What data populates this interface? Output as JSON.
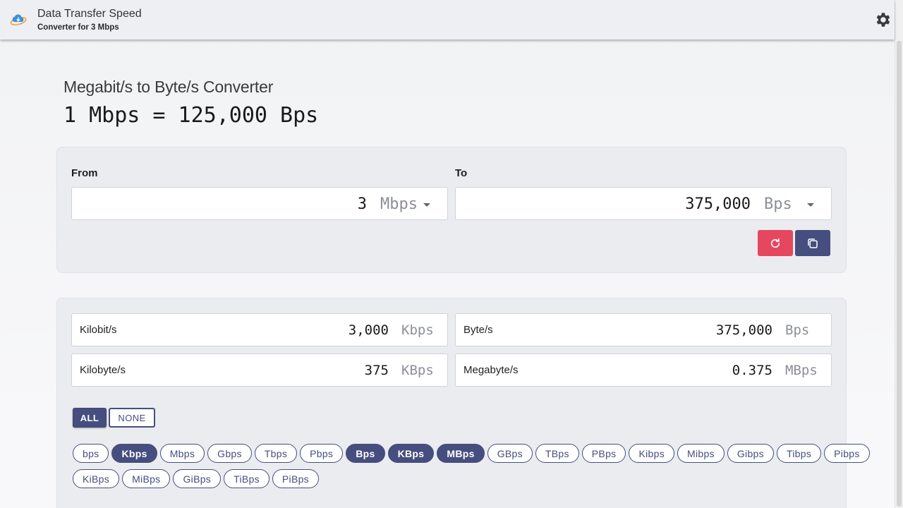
{
  "header": {
    "title": "Data Transfer Speed",
    "subtitle": "Converter for 3 Mbps",
    "logo_icon": "cloud-transfer-icon",
    "settings_icon": "gear-icon"
  },
  "page": {
    "heading": "Megabit/s to Byte/s Converter",
    "formula": "1 Mbps = 125,000 Bps"
  },
  "converter": {
    "from_label": "From",
    "to_label": "To",
    "from_value": "3",
    "from_unit": "Mbps",
    "to_value": "375,000",
    "to_unit": "Bps",
    "reset_icon": "refresh-icon",
    "copy_icon": "copy-icon"
  },
  "results": [
    {
      "label": "Kilobit/s",
      "value": "3,000",
      "unit": "Kbps"
    },
    {
      "label": "Byte/s",
      "value": "375,000",
      "unit": "Bps"
    },
    {
      "label": "Kilobyte/s",
      "value": "375",
      "unit": "KBps"
    },
    {
      "label": "Megabyte/s",
      "value": "0.375",
      "unit": "MBps"
    }
  ],
  "selection": {
    "all_label": "ALL",
    "none_label": "NONE"
  },
  "units_row1": [
    {
      "label": "bps",
      "selected": false
    },
    {
      "label": "Kbps",
      "selected": true
    },
    {
      "label": "Mbps",
      "selected": false
    },
    {
      "label": "Gbps",
      "selected": false
    },
    {
      "label": "Tbps",
      "selected": false
    },
    {
      "label": "Pbps",
      "selected": false
    },
    {
      "label": "Bps",
      "selected": true
    },
    {
      "label": "KBps",
      "selected": true
    },
    {
      "label": "MBps",
      "selected": true
    },
    {
      "label": "GBps",
      "selected": false
    },
    {
      "label": "TBps",
      "selected": false
    },
    {
      "label": "PBps",
      "selected": false
    },
    {
      "label": "Kibps",
      "selected": false
    },
    {
      "label": "Mibps",
      "selected": false
    },
    {
      "label": "Gibps",
      "selected": false
    },
    {
      "label": "Tibps",
      "selected": false
    },
    {
      "label": "Pibps",
      "selected": false
    }
  ],
  "units_row2": [
    {
      "label": "KiBps",
      "selected": false
    },
    {
      "label": "MiBps",
      "selected": false
    },
    {
      "label": "GiBps",
      "selected": false
    },
    {
      "label": "TiBps",
      "selected": false
    },
    {
      "label": "PiBps",
      "selected": false
    }
  ],
  "colors": {
    "accent": "#454e7e",
    "reset": "#e5475f"
  }
}
